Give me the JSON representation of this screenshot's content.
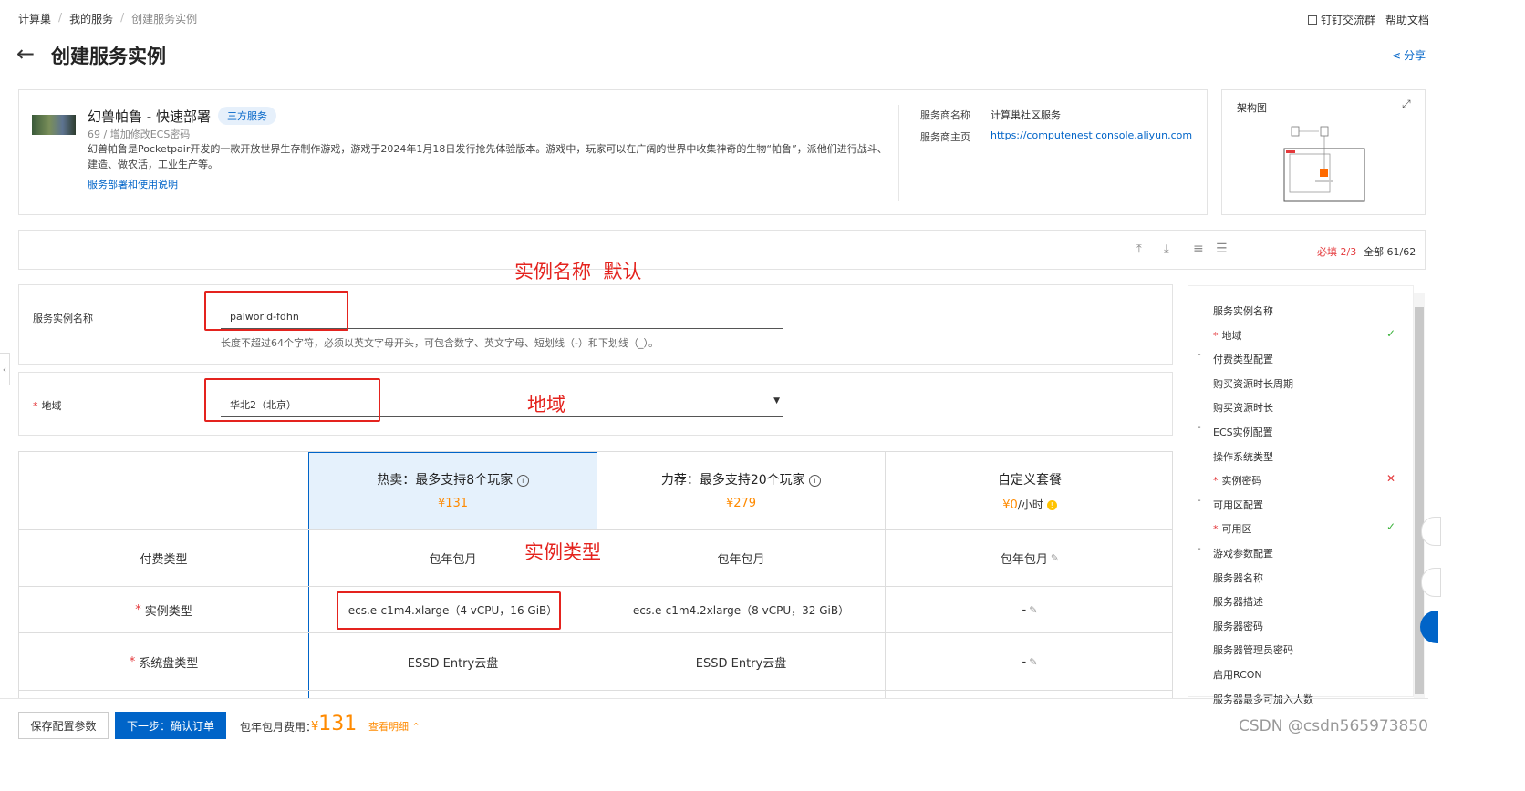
{
  "breadcrumb": [
    "计算巢",
    "我的服务",
    "创建服务实例"
  ],
  "breadcrumb_sep": "/",
  "header_links": {
    "dingtalk": "钉钉交流群",
    "help": "帮助文档"
  },
  "page_title": "创建服务实例",
  "share_label": "分享",
  "service": {
    "name": "幻兽帕鲁 - 快速部署",
    "badge": "三方服务",
    "meta": "69 / 增加修改ECS密码",
    "description": "幻兽帕鲁是Pocketpair开发的一款开放世界生存制作游戏，游戏于2024年1月18日发行抢先体验版本。游戏中，玩家可以在广阔的世界中收集神奇的生物“帕鲁”，派他们进行战斗、建造、做农活，工业生产等。",
    "doc_link": "服务部署和使用说明",
    "provider_label": "服务商名称",
    "provider_value": "计算巢社区服务",
    "homepage_label": "服务商主页",
    "homepage_value": "https://computenest.console.aliyun.com"
  },
  "arch_title": "架构图",
  "toolbar_stats": {
    "required_label": "必填",
    "required_value": "2/3",
    "all_label": "全部",
    "all_value": "61/62"
  },
  "annotations": {
    "instance_name": "实例名称  默认",
    "region": "地域",
    "instance_type": "实例类型"
  },
  "instance_name": {
    "label": "服务实例名称",
    "value": "palworld-fdhn",
    "hint": "长度不超过64个字符，必须以英文字母开头，可包含数字、英文字母、短划线（-）和下划线（_）。"
  },
  "region": {
    "label": "地域",
    "value": "华北2（北京）"
  },
  "plans": [
    {
      "title": "热卖：最多支持8个玩家",
      "price": "¥131",
      "price_unit": "",
      "pay_type": "包年包月",
      "instance_type": "ecs.e-c1m4.xlarge（4 vCPU，16 GiB）",
      "disk": "ESSD Entry云盘"
    },
    {
      "title": "力荐：最多支持20个玩家",
      "price": "¥279",
      "price_unit": "",
      "pay_type": "包年包月",
      "instance_type": "ecs.e-c1m4.2xlarge（8 vCPU，32 GiB）",
      "disk": "ESSD Entry云盘"
    },
    {
      "title": "自定义套餐",
      "price": "¥0",
      "price_unit": "/小时",
      "pay_type": "包年包月",
      "instance_type": "-",
      "disk": "-"
    }
  ],
  "row_labels": {
    "pay_type": "付费类型",
    "instance_type": "实例类型",
    "disk": "系统盘类型"
  },
  "side_nav": [
    {
      "label": "服务实例名称",
      "required": false,
      "status": ""
    },
    {
      "label": "地域",
      "required": true,
      "status": "ok"
    },
    {
      "label": "付费类型配置",
      "required": false,
      "status": "",
      "group": true
    },
    {
      "label": "购买资源时长周期",
      "required": false,
      "status": ""
    },
    {
      "label": "购买资源时长",
      "required": false,
      "status": ""
    },
    {
      "label": "ECS实例配置",
      "required": false,
      "status": "",
      "group": true
    },
    {
      "label": "操作系统类型",
      "required": false,
      "status": ""
    },
    {
      "label": "实例密码",
      "required": true,
      "status": "error"
    },
    {
      "label": "可用区配置",
      "required": false,
      "status": "",
      "group": true
    },
    {
      "label": "可用区",
      "required": true,
      "status": "ok"
    },
    {
      "label": "游戏参数配置",
      "required": false,
      "status": "",
      "group": true
    },
    {
      "label": "服务器名称",
      "required": false,
      "status": ""
    },
    {
      "label": "服务器描述",
      "required": false,
      "status": ""
    },
    {
      "label": "服务器密码",
      "required": false,
      "status": ""
    },
    {
      "label": "服务器管理员密码",
      "required": false,
      "status": ""
    },
    {
      "label": "启用RCON",
      "required": false,
      "status": ""
    },
    {
      "label": "服务器最多可加入人数",
      "required": false,
      "status": ""
    }
  ],
  "footer": {
    "save_label": "保存配置参数",
    "next_label": "下一步：确认订单",
    "fee_label": "包年包月费用：",
    "fee_currency": "¥",
    "fee_value": "131",
    "detail_label": "查看明细"
  },
  "watermark": "CSDN @csdn565973850",
  "colors": {
    "primary": "#0064c8",
    "price": "#ff8a00",
    "error": "#e4393c",
    "ok": "#3db33d",
    "annotation": "#e4231e"
  }
}
